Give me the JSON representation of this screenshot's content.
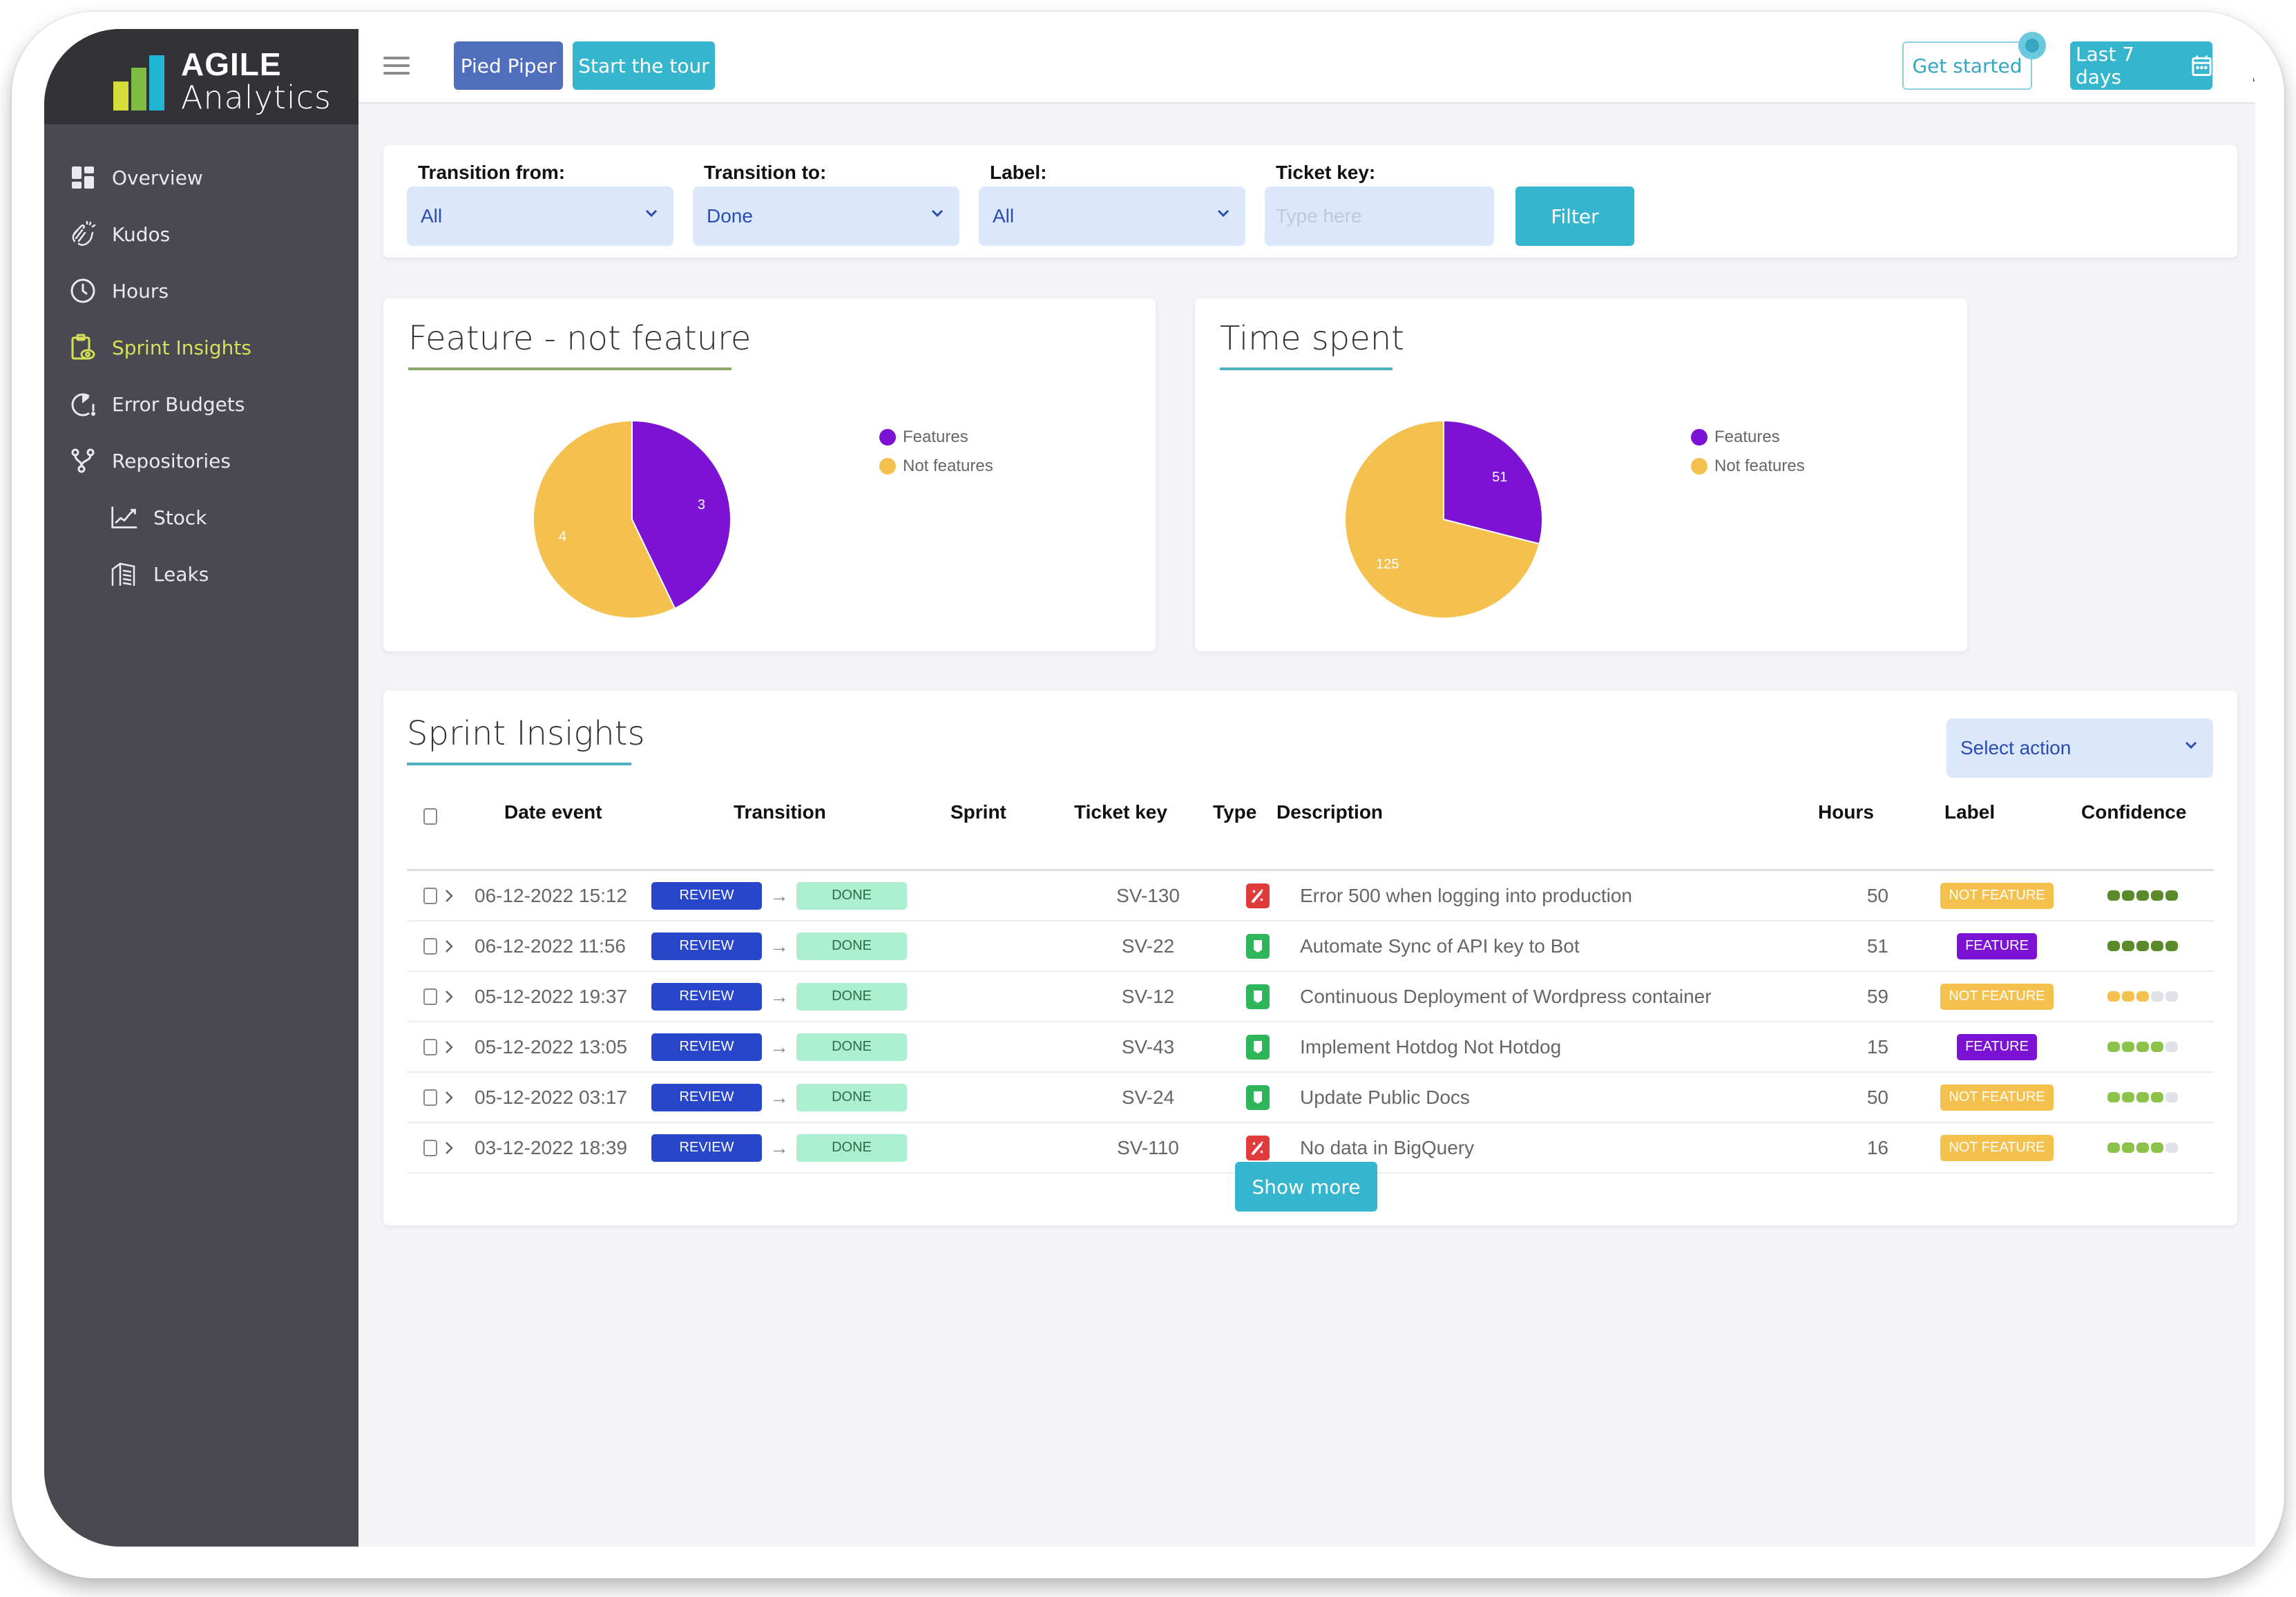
{
  "brand": {
    "line1": "AGILE",
    "line2": "Analytics",
    "bar_colors": [
      "#d4dc38",
      "#7fbd42",
      "#22b6d5"
    ]
  },
  "sidebar": {
    "items": [
      {
        "label": "Overview",
        "icon": "dashboard-icon",
        "active": false
      },
      {
        "label": "Kudos",
        "icon": "clapping-hands-icon",
        "active": false
      },
      {
        "label": "Hours",
        "icon": "clock-icon",
        "active": false
      },
      {
        "label": "Sprint Insights",
        "icon": "clipboard-eye-icon",
        "active": true
      },
      {
        "label": "Error Budgets",
        "icon": "gauge-alert-icon",
        "active": false
      },
      {
        "label": "Repositories",
        "icon": "git-branch-icon",
        "active": false
      },
      {
        "label": "Stock",
        "icon": "line-chart-icon",
        "active": false,
        "sub": true
      },
      {
        "label": "Leaks",
        "icon": "leaks-icon",
        "active": false,
        "sub": true
      }
    ],
    "active_color": "#d4e157"
  },
  "topbar": {
    "org_button": "Pied Piper",
    "tour_button": "Start the tour",
    "get_started": "Get started",
    "date_range": "Last 7 days"
  },
  "filters": {
    "transition_from": {
      "label": "Transition from:",
      "value": "All"
    },
    "transition_to": {
      "label": "Transition to:",
      "value": "Done"
    },
    "label": {
      "label": "Label:",
      "value": "All"
    },
    "ticket_key": {
      "label": "Ticket key:",
      "placeholder": "Type here",
      "value": ""
    },
    "filter_button": "Filter"
  },
  "chart_data": [
    {
      "type": "pie",
      "title": "Feature - not feature",
      "categories": [
        "Features",
        "Not features"
      ],
      "values": [
        3,
        4
      ],
      "colors": [
        "#7b12d4",
        "#f5c14e"
      ],
      "legend": "right",
      "underline_color": "#8aa867"
    },
    {
      "type": "pie",
      "title": "Time spent",
      "categories": [
        "Features",
        "Not features"
      ],
      "values": [
        51,
        125
      ],
      "colors": [
        "#7b12d4",
        "#f5c14e"
      ],
      "legend": "right",
      "underline_color": "#4cb0bd"
    }
  ],
  "table": {
    "title": "Sprint Insights",
    "select_action": "Select action",
    "columns": [
      "Date event",
      "Transition",
      "Sprint",
      "Ticket key",
      "Type",
      "Description",
      "Hours",
      "Label",
      "Confidence"
    ],
    "rows": [
      {
        "date": "06-12-2022 15:12",
        "from": "REVIEW",
        "to": "DONE",
        "sprint": "",
        "key": "SV-130",
        "type": "bug",
        "description": "Error 500 when logging into production",
        "hours": "50",
        "label": "NOT FEATURE",
        "confidence": 5,
        "confidence_color": "#5a8a2a"
      },
      {
        "date": "06-12-2022 11:56",
        "from": "REVIEW",
        "to": "DONE",
        "sprint": "",
        "key": "SV-22",
        "type": "story",
        "description": "Automate Sync of API key to Bot",
        "hours": "51",
        "label": "FEATURE",
        "confidence": 5,
        "confidence_color": "#5a8a2a"
      },
      {
        "date": "05-12-2022 19:37",
        "from": "REVIEW",
        "to": "DONE",
        "sprint": "",
        "key": "SV-12",
        "type": "story",
        "description": "Continuous Deployment of Wordpress container",
        "hours": "59",
        "label": "NOT FEATURE",
        "confidence": 3,
        "confidence_color": "#f5c14e"
      },
      {
        "date": "05-12-2022 13:05",
        "from": "REVIEW",
        "to": "DONE",
        "sprint": "",
        "key": "SV-43",
        "type": "story",
        "description": "Implement Hotdog Not Hotdog",
        "hours": "15",
        "label": "FEATURE",
        "confidence": 4,
        "confidence_color": "#8bc34a"
      },
      {
        "date": "05-12-2022 03:17",
        "from": "REVIEW",
        "to": "DONE",
        "sprint": "",
        "key": "SV-24",
        "type": "story",
        "description": "Update Public Docs",
        "hours": "50",
        "label": "NOT FEATURE",
        "confidence": 4,
        "confidence_color": "#8bc34a"
      },
      {
        "date": "03-12-2022 18:39",
        "from": "REVIEW",
        "to": "DONE",
        "sprint": "",
        "key": "SV-110",
        "type": "bug",
        "description": "No data in BigQuery",
        "hours": "16",
        "label": "NOT FEATURE",
        "confidence": 4,
        "confidence_color": "#8bc34a"
      }
    ],
    "show_more": "Show more",
    "label_colors": {
      "FEATURE": "#7b12d4",
      "NOT FEATURE": "#f5c14e"
    },
    "type_colors": {
      "bug": "#e03b3b",
      "story": "#2fb55a"
    }
  }
}
